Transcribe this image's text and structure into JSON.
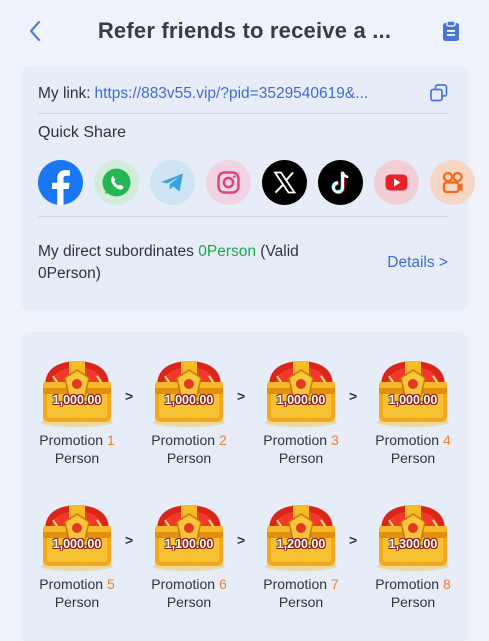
{
  "header": {
    "title": "Refer friends to receive a ...",
    "back_icon": "chevron-left-icon",
    "clipboard_icon": "clipboard-icon"
  },
  "share": {
    "link_label": "My link:",
    "link_url": "https://883v55.vip/?pid=3529540619&...",
    "quick_share_title": "Quick Share",
    "icons": [
      "facebook-icon",
      "whatsapp-icon",
      "telegram-icon",
      "instagram-icon",
      "x-icon",
      "tiktok-icon",
      "youtube-icon",
      "kwai-icon"
    ],
    "subordinates_prefix": "My direct subordinates ",
    "subordinates_count": "0Person",
    "subordinates_valid": " (Valid 0Person)",
    "details_label": "Details >"
  },
  "promotions": [
    {
      "amount": "1,000.00",
      "label": "Promotion",
      "num": "1",
      "unit": "Person"
    },
    {
      "amount": "1,000.00",
      "label": "Promotion",
      "num": "2",
      "unit": "Person"
    },
    {
      "amount": "1,000.00",
      "label": "Promotion",
      "num": "3",
      "unit": "Person"
    },
    {
      "amount": "1,000.00",
      "label": "Promotion",
      "num": "4",
      "unit": "Person"
    },
    {
      "amount": "1,000.00",
      "label": "Promotion",
      "num": "5",
      "unit": "Person"
    },
    {
      "amount": "1,100.00",
      "label": "Promotion",
      "num": "6",
      "unit": "Person"
    },
    {
      "amount": "1,200.00",
      "label": "Promotion",
      "num": "7",
      "unit": "Person"
    },
    {
      "amount": "1,300.00",
      "label": "Promotion",
      "num": "8",
      "unit": "Person"
    }
  ],
  "arrow_glyph": ">",
  "colors": {
    "accent_blue": "#3f6bd0",
    "green": "#1aa84a",
    "orange": "#e8822c"
  }
}
